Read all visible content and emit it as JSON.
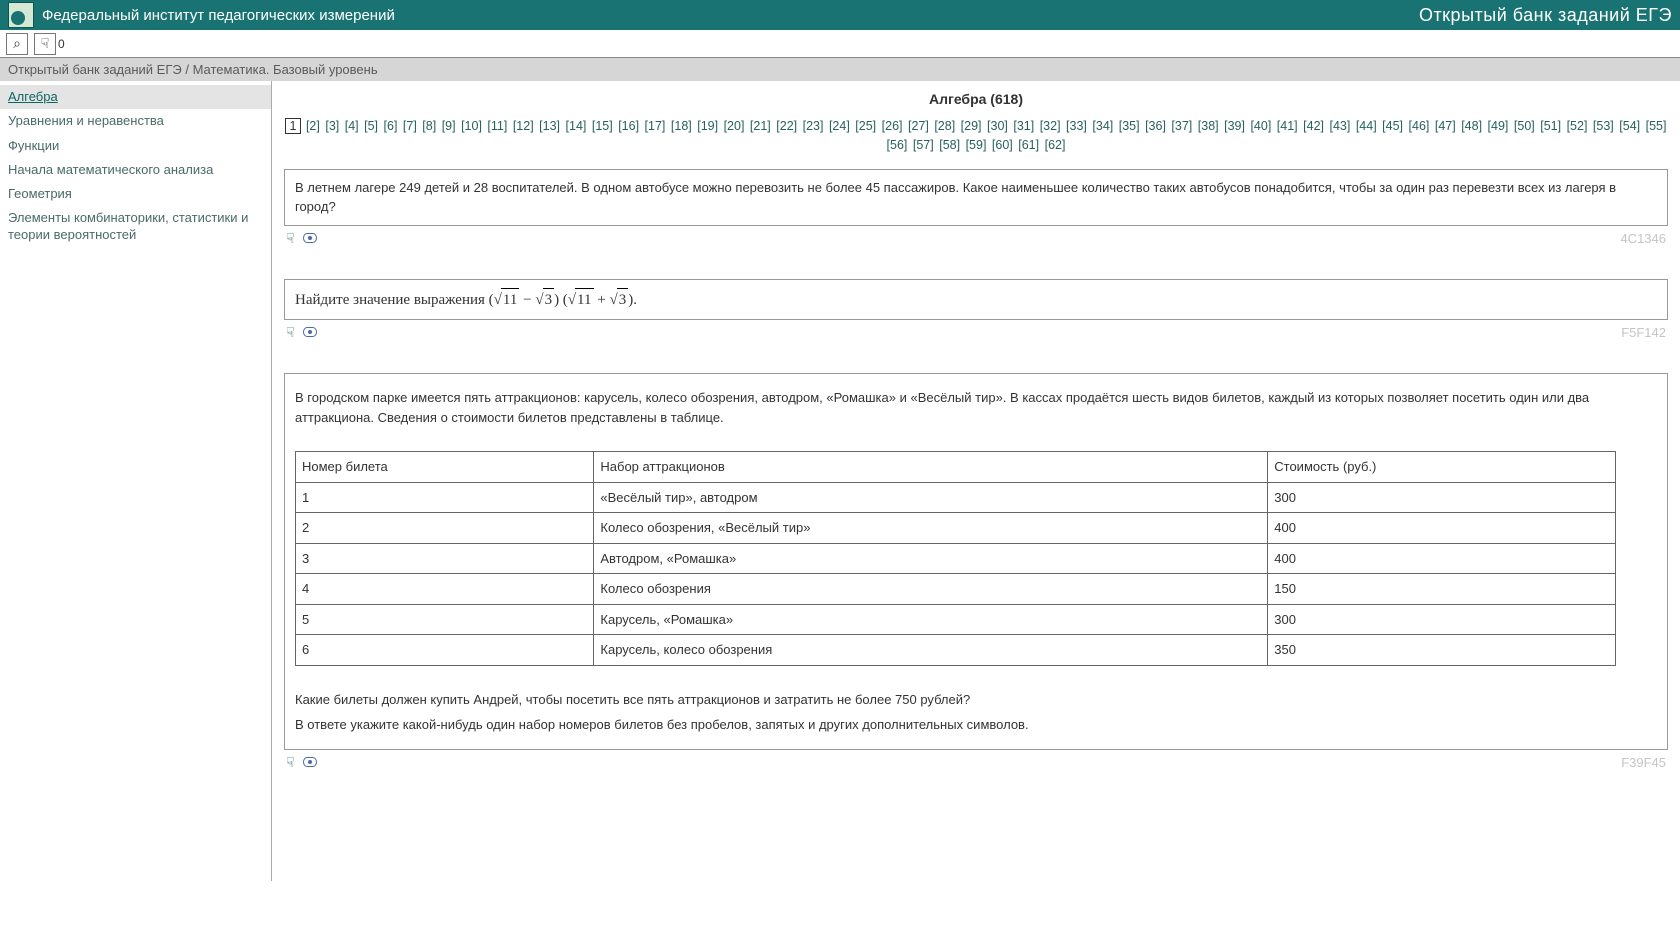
{
  "header": {
    "site_title": "Федеральный институт педагогических измерений",
    "right_title": "Открытый банк заданий ЕГЭ"
  },
  "toolbar": {
    "selected_count": "0"
  },
  "breadcrumb": {
    "root": "Открытый банк заданий ЕГЭ",
    "sep": " / ",
    "current": "Математика. Базовый уровень"
  },
  "sidebar": {
    "items": [
      {
        "label": "Алгебра",
        "active": true
      },
      {
        "label": "Уравнения и неравенства",
        "active": false
      },
      {
        "label": "Функции",
        "active": false
      },
      {
        "label": "Начала математического анализа",
        "active": false
      },
      {
        "label": "Геометрия",
        "active": false
      },
      {
        "label": "Элементы комбинаторики, статистики и теории вероятностей",
        "active": false
      }
    ]
  },
  "main": {
    "section_title": "Алгебра (618)",
    "pager": {
      "current": 1,
      "total": 62
    },
    "tasks": [
      {
        "id": "4C1346",
        "text": "В летнем лагере 249 детей и 28 воспитателей. В одном автобусе можно перевозить не более 45 пассажиров. Какое наименьшее количество таких автобусов понадобится, чтобы за один раз перевезти всех из лагеря в город?"
      },
      {
        "id": "F5F142",
        "text_prefix": "Найдите значение выражения ",
        "expr": {
          "a": "11",
          "b": "3",
          "c": "11",
          "d": "3"
        },
        "text_suffix": "."
      },
      {
        "id": "F39F45",
        "intro1": "В городском парке имеется пять аттракционов: карусель, колесо обозрения, автодром, «Ромашка» и «Весёлый тир». В кассах продаётся шесть видов билетов, каждый из которых позволяет посетить один или два аттракциона. Сведения о стоимости билетов представлены в таблице.",
        "table": {
          "headers": [
            "Номер билета",
            "Набор аттракционов",
            "Стоимость (руб.)"
          ],
          "rows": [
            [
              "1",
              "«Весёлый тир», автодром",
              "300"
            ],
            [
              "2",
              "Колесо обозрения, «Весёлый тир»",
              "400"
            ],
            [
              "3",
              "Автодром, «Ромашка»",
              "400"
            ],
            [
              "4",
              "Колесо обозрения",
              "150"
            ],
            [
              "5",
              "Карусель, «Ромашка»",
              "300"
            ],
            [
              "6",
              "Карусель, колесо обозрения",
              "350"
            ]
          ]
        },
        "q1": "Какие билеты должен купить Андрей, чтобы посетить все пять аттракционов и затратить не более 750 рублей?",
        "q2": "В ответе укажите какой-нибудь один набор номеров билетов без пробелов, запятых и других дополнительных символов."
      }
    ]
  }
}
